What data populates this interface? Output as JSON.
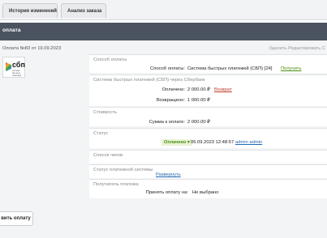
{
  "tabs": [
    "История изменений",
    "Анализ заказа"
  ],
  "title": "оплата",
  "order_number": "Оплата №83 от 19.09.2023",
  "top_actions": "Удалить  Редактировать  С",
  "logo_text": "сбп",
  "logo_subtext": "система быстрых платежей",
  "sections": {
    "payment_method": {
      "title": "Способ оплаты",
      "label": "Способ оплаты:",
      "value": "Система быстрых платежей (СБП) [24]",
      "action": "Получить"
    },
    "sbp": {
      "title": "Система быстрых платежей (СБП) через Сбербанк",
      "paid_label": "Оплачено:",
      "paid_value": "2 000.00 ₽",
      "refund_link": "Возврат",
      "returned_label": "Возвращено:",
      "returned_value": "1 000.00 ₽"
    },
    "cost": {
      "title": "Стоимость",
      "label": "Сумма к оплате:",
      "value": "2 000.00 ₽"
    },
    "status": {
      "title": "Статус",
      "selected": "Оплачено",
      "date": "06.09.2023 12:48:57",
      "user": "admin admin"
    },
    "checks": {
      "title": "Список чеков"
    },
    "payment_system_status": {
      "title": "Статус платежной системы",
      "link": "Развернуть"
    },
    "receiver": {
      "title": "Получатель платежа",
      "label": "Принять оплату на:",
      "value": "Не выбрано"
    }
  },
  "save_button": "вить оплату"
}
